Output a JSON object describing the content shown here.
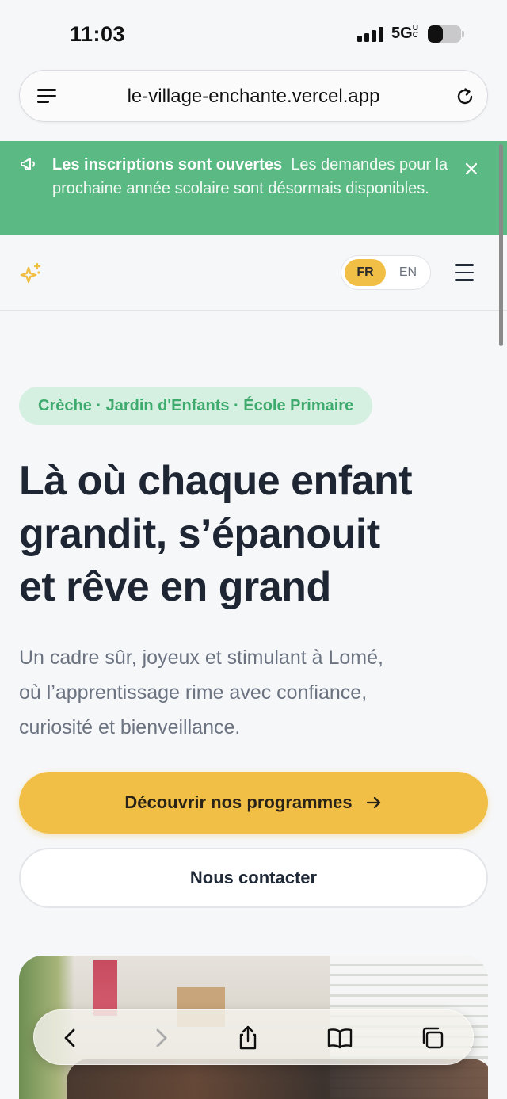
{
  "status_bar": {
    "time": "11:03",
    "network": "5G",
    "network_suffix": "UC",
    "battery_fraction": 0.45
  },
  "browser": {
    "url": "le-village-enchante.vercel.app"
  },
  "banner": {
    "title": "Les inscriptions sont ouvertes",
    "message": "Les demandes pour la prochaine année scolaire sont désormais disponibles.",
    "background": "#5bba83"
  },
  "header": {
    "lang_options": [
      "FR",
      "EN"
    ],
    "lang_selected": "FR",
    "accent": "#f2bf46"
  },
  "hero": {
    "tag": "Crèche · Jardin d'Enfants · École Primaire",
    "title_lines": [
      "Là où chaque enfant",
      "grandit, s’épanouit",
      "et rêve en grand"
    ],
    "subtitle_lines": [
      "Un cadre sûr, joyeux et stimulant à Lomé,",
      "où l’apprentissage rime avec confiance,",
      "curiosité et bienveillance."
    ],
    "primary_cta": "Découvrir nos programmes",
    "secondary_cta": "Nous contacter"
  },
  "toolbar": {
    "icons": [
      "back-icon",
      "forward-icon",
      "share-icon",
      "bookmarks-icon",
      "tabs-icon"
    ]
  }
}
